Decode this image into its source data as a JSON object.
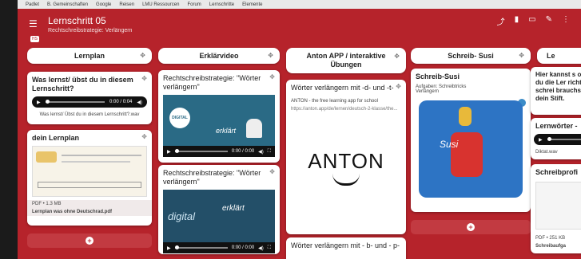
{
  "bookmarks": [
    "Padlet",
    "B. Gemeinschaften",
    "Google",
    "Reisen",
    "LMU Ressourcen",
    "Forum",
    "Lernschritte",
    "Elemente"
  ],
  "header": {
    "title": "Lernschritt 05",
    "subtitle": "Rechtschreibstrategie: Verlängern",
    "badge": "HS"
  },
  "columns": [
    {
      "title": "Lernplan"
    },
    {
      "title": "Erklärvideo"
    },
    {
      "title": "Anton APP / interaktive Übungen"
    },
    {
      "title": "Schreib- Susi"
    },
    {
      "title": "Le"
    }
  ],
  "cards": {
    "c1": {
      "title": "Was lernst/ übst du in diesem Lernschritt?",
      "time": "0:00 / 0:04",
      "caption": "Was lernst/ Übst du in diesem Lernschritt?.wav"
    },
    "c2": {
      "title": "dein Lernplan",
      "file": "PDF • 1.3 MB",
      "filename": "Lernplan was ohne Deutschrad.pdf"
    },
    "c3": {
      "title": "Rechtschreibstrategie: \"Wörter verlängern\"",
      "logo": "DIGITAL",
      "overlay": "erklärt",
      "time": "0:00 / 0:00"
    },
    "c4": {
      "title": "Rechtschreibstrategie: \"Wörter verlängern\"",
      "logo": "digital",
      "overlay": "erklärt",
      "time": "0:00 / 0:00"
    },
    "c5": {
      "title": "Wörter verlängern mit -d- und -t-",
      "link_title": "ANTON - the free learning app for school",
      "url": "https://anton.app/de/lernen/deutsch-2-klasse/the...",
      "logo": "ANTON"
    },
    "c6": {
      "title": "Wörter verlängern mit - b- und - p-"
    },
    "c7": {
      "title": "Schreib-Susi",
      "desc1": "Aufgaben: Schreibtricks",
      "desc2": "Verlängern",
      "image_text": "Susi"
    },
    "c8": {
      "text": "Hier kannst s ob du die Ler richtig schrei brauchst dein Stift."
    },
    "c9": {
      "title": "Lernwörter -",
      "file": "Diktat.wav"
    },
    "c10": {
      "title": "Schreibprofi",
      "file": "PDF • 251 KB",
      "filename": "Schreibaufga"
    }
  }
}
